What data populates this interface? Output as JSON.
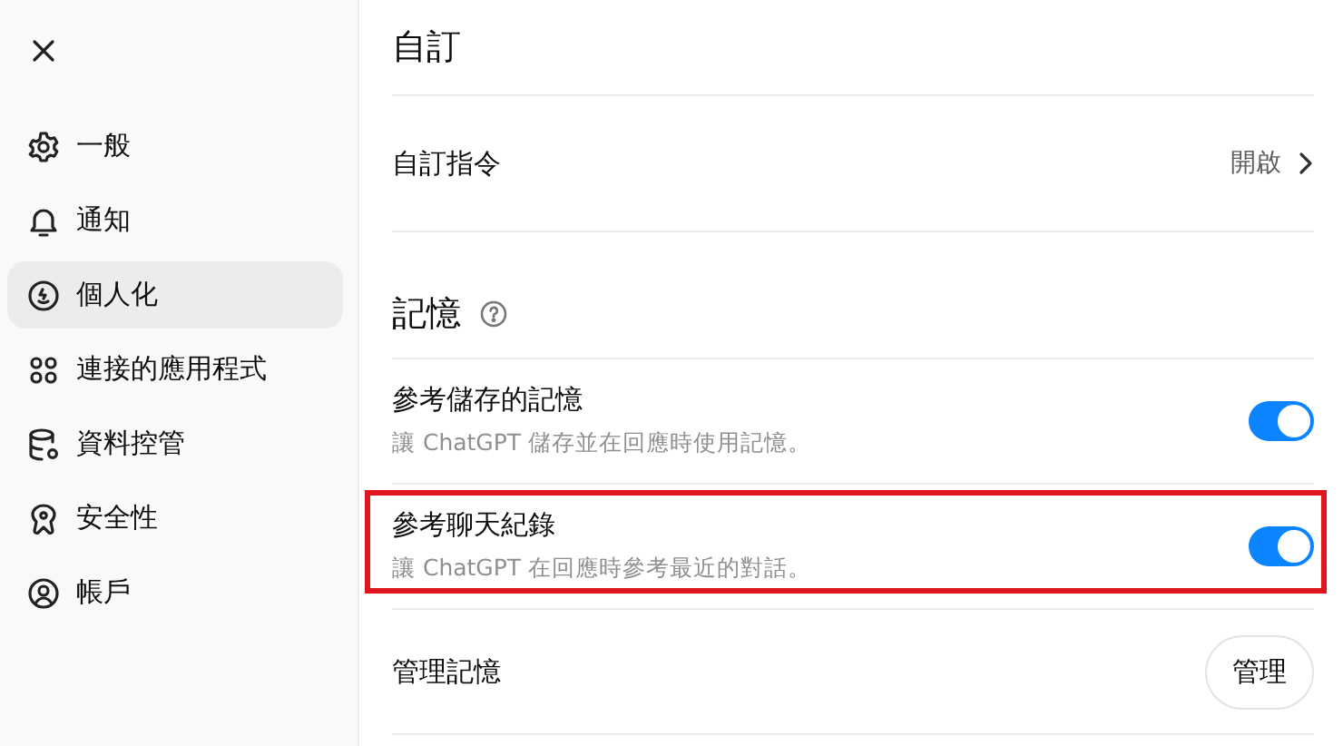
{
  "sidebar": {
    "items": [
      {
        "label": "一般",
        "selected": false
      },
      {
        "label": "通知",
        "selected": false
      },
      {
        "label": "個人化",
        "selected": true
      },
      {
        "label": "連接的應用程式",
        "selected": false
      },
      {
        "label": "資料控管",
        "selected": false
      },
      {
        "label": "安全性",
        "selected": false
      },
      {
        "label": "帳戶",
        "selected": false
      }
    ]
  },
  "sections": [
    {
      "title": "自訂",
      "help": false,
      "rows": [
        {
          "kind": "link",
          "label": "自訂指令",
          "value": "開啟"
        }
      ]
    },
    {
      "title": "記憶",
      "help": true,
      "rows": [
        {
          "kind": "toggle",
          "label": "參考儲存的記憶",
          "description": "讓 ChatGPT 儲存並在回應時使用記憶。",
          "on": true,
          "highlighted": false
        },
        {
          "kind": "toggle",
          "label": "參考聊天紀錄",
          "description": "讓 ChatGPT 在回應時參考最近的對話。",
          "on": true,
          "highlighted": true
        },
        {
          "kind": "button",
          "label": "管理記憶",
          "button": "管理"
        }
      ]
    }
  ]
}
